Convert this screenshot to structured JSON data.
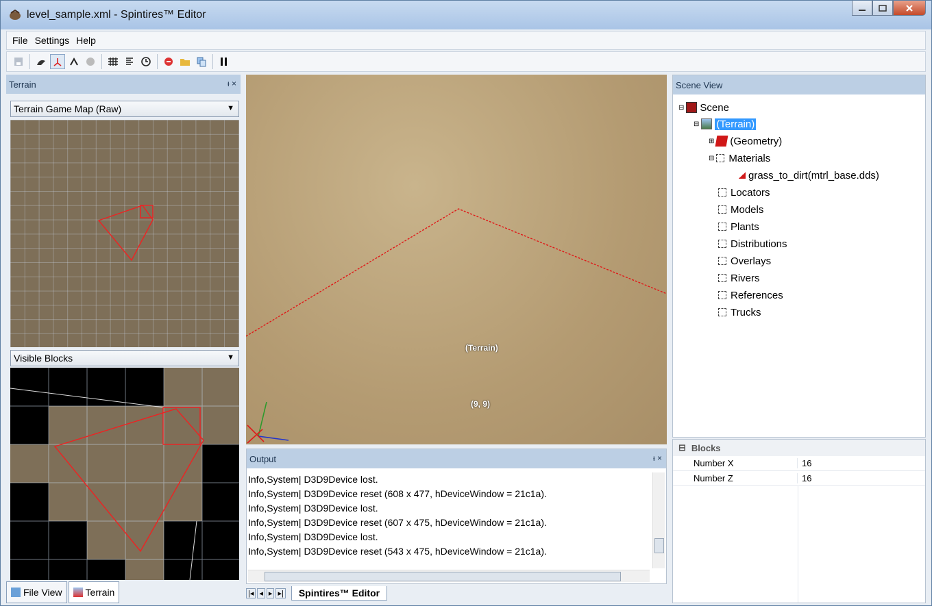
{
  "window": {
    "title": "level_sample.xml - Spintires™ Editor"
  },
  "menu": {
    "items": [
      "File",
      "Settings",
      "Help"
    ]
  },
  "terrain_panel": {
    "title": "Terrain",
    "pin_close": "ᵻ ×",
    "map_dropdown": "Terrain Game Map (Raw)",
    "blocks_dropdown": "Visible Blocks"
  },
  "viewport": {
    "label_terrain": "(Terrain)",
    "label_coords": "(9, 9)"
  },
  "scene_view": {
    "title": "Scene View",
    "nodes": {
      "scene": "Scene",
      "terrain": "(Terrain)",
      "geometry": "(Geometry)",
      "materials": "Materials",
      "material_item": "grass_to_dirt(mtrl_base.dds)",
      "locators": "Locators",
      "models": "Models",
      "plants": "Plants",
      "distributions": "Distributions",
      "overlays": "Overlays",
      "rivers": "Rivers",
      "references": "References",
      "trucks": "Trucks"
    }
  },
  "properties": {
    "category": "Blocks",
    "rows": [
      {
        "name": "Number X",
        "value": "16"
      },
      {
        "name": "Number Z",
        "value": "16"
      }
    ]
  },
  "output": {
    "title": "Output",
    "lines": [
      "Info,System| D3D9Device lost.",
      "Info,System| D3D9Device reset (608 x 477, hDeviceWindow = 21c1a).",
      "Info,System| D3D9Device lost.",
      "Info,System| D3D9Device reset (607 x 475, hDeviceWindow = 21c1a).",
      "Info,System| D3D9Device lost.",
      "Info,System| D3D9Device reset (543 x 475, hDeviceWindow = 21c1a)."
    ]
  },
  "bottom_tabs": {
    "file_view": "File View",
    "terrain": "Terrain",
    "doc_tab": "Spintires™ Editor"
  }
}
